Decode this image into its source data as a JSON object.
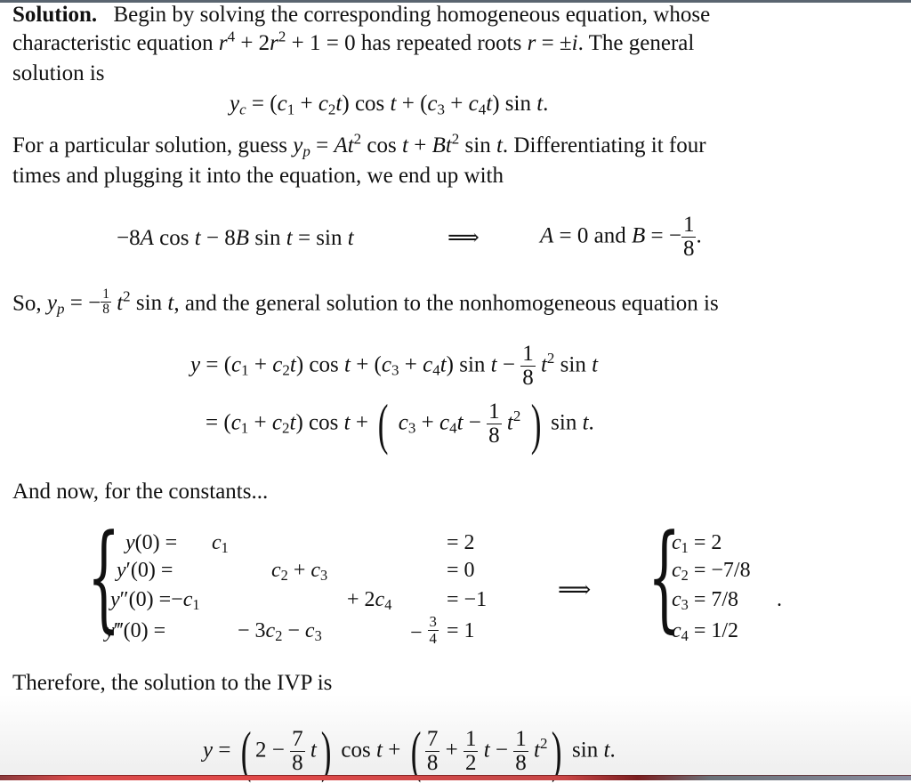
{
  "document": {
    "heading": "Solution.",
    "para1": {
      "line1_rest": "Begin by solving the corresponding homogeneous equation, whose",
      "line2_pre": "characteristic equation",
      "char_eq": "r⁴ + 2r² + 1 = 0",
      "line2_mid": "has repeated roots",
      "roots": "r = ±i",
      "line2_post": ". The general",
      "line3": "solution is"
    },
    "eq_yc": "y_c = (c₁ + c₂t) cos t + (c₃ + c₄t) sin t.",
    "para2": {
      "line1_pre": "For a particular solution, guess",
      "guess": "y_p = At² cos t + Bt² sin t",
      "line1_post": ". Differentiating it four",
      "line2": "times and plugging it into the equation, we end up with"
    },
    "eq_coeffs": {
      "lhs": "−8A cos t − 8B sin t = sin t",
      "implies": "⟹",
      "rhs_pre": "A = 0 and B = −",
      "frac_num": "1",
      "frac_den": "8",
      "rhs_post": "."
    },
    "para3": {
      "pre": "So,",
      "yp": "y_p = −(1/8) t² sin t",
      "post": ", and the general solution to the nonhomogeneous equation is"
    },
    "eq_general": {
      "line1": "y = (c₁ + c₂t) cos t + (c₃ + c₄t) sin t − (1/8) t² sin t",
      "line2": "= (c₁ + c₂t) cos t + (c₃ + c₄t − (1/8) t²) sin t."
    },
    "para4": "And now, for the constants...",
    "system": {
      "rows": [
        {
          "lhs": "y(0) =",
          "terms": "c₁",
          "rhs": "= 2"
        },
        {
          "lhs": "y′(0) =",
          "terms": "c₂ + c₃",
          "rhs": "= 0"
        },
        {
          "lhs": "y″(0) =",
          "terms": "−c₁ + 2c₄",
          "rhs": "= −1"
        },
        {
          "lhs": "y‴(0) =",
          "terms": "− 3c₂ − c₃ − 3/4",
          "rhs": "= 1"
        }
      ],
      "implies": "⟹",
      "solutions": [
        {
          "var": "c₁",
          "value": "2"
        },
        {
          "var": "c₂",
          "value": "−7/8"
        },
        {
          "var": "c₃",
          "value": "7/8"
        },
        {
          "var": "c₄",
          "value": "1/2"
        }
      ],
      "end_punct": "."
    },
    "para5": "Therefore, the solution to the IVP is",
    "eq_final": "y = (2 − (7/8) t) cos t + (7/8 + (1/2) t − (1/8) t²) sin t."
  },
  "colors": {
    "text": "#111111",
    "top_border": "#5a6570",
    "bottom_bar_red": "#e04848"
  }
}
